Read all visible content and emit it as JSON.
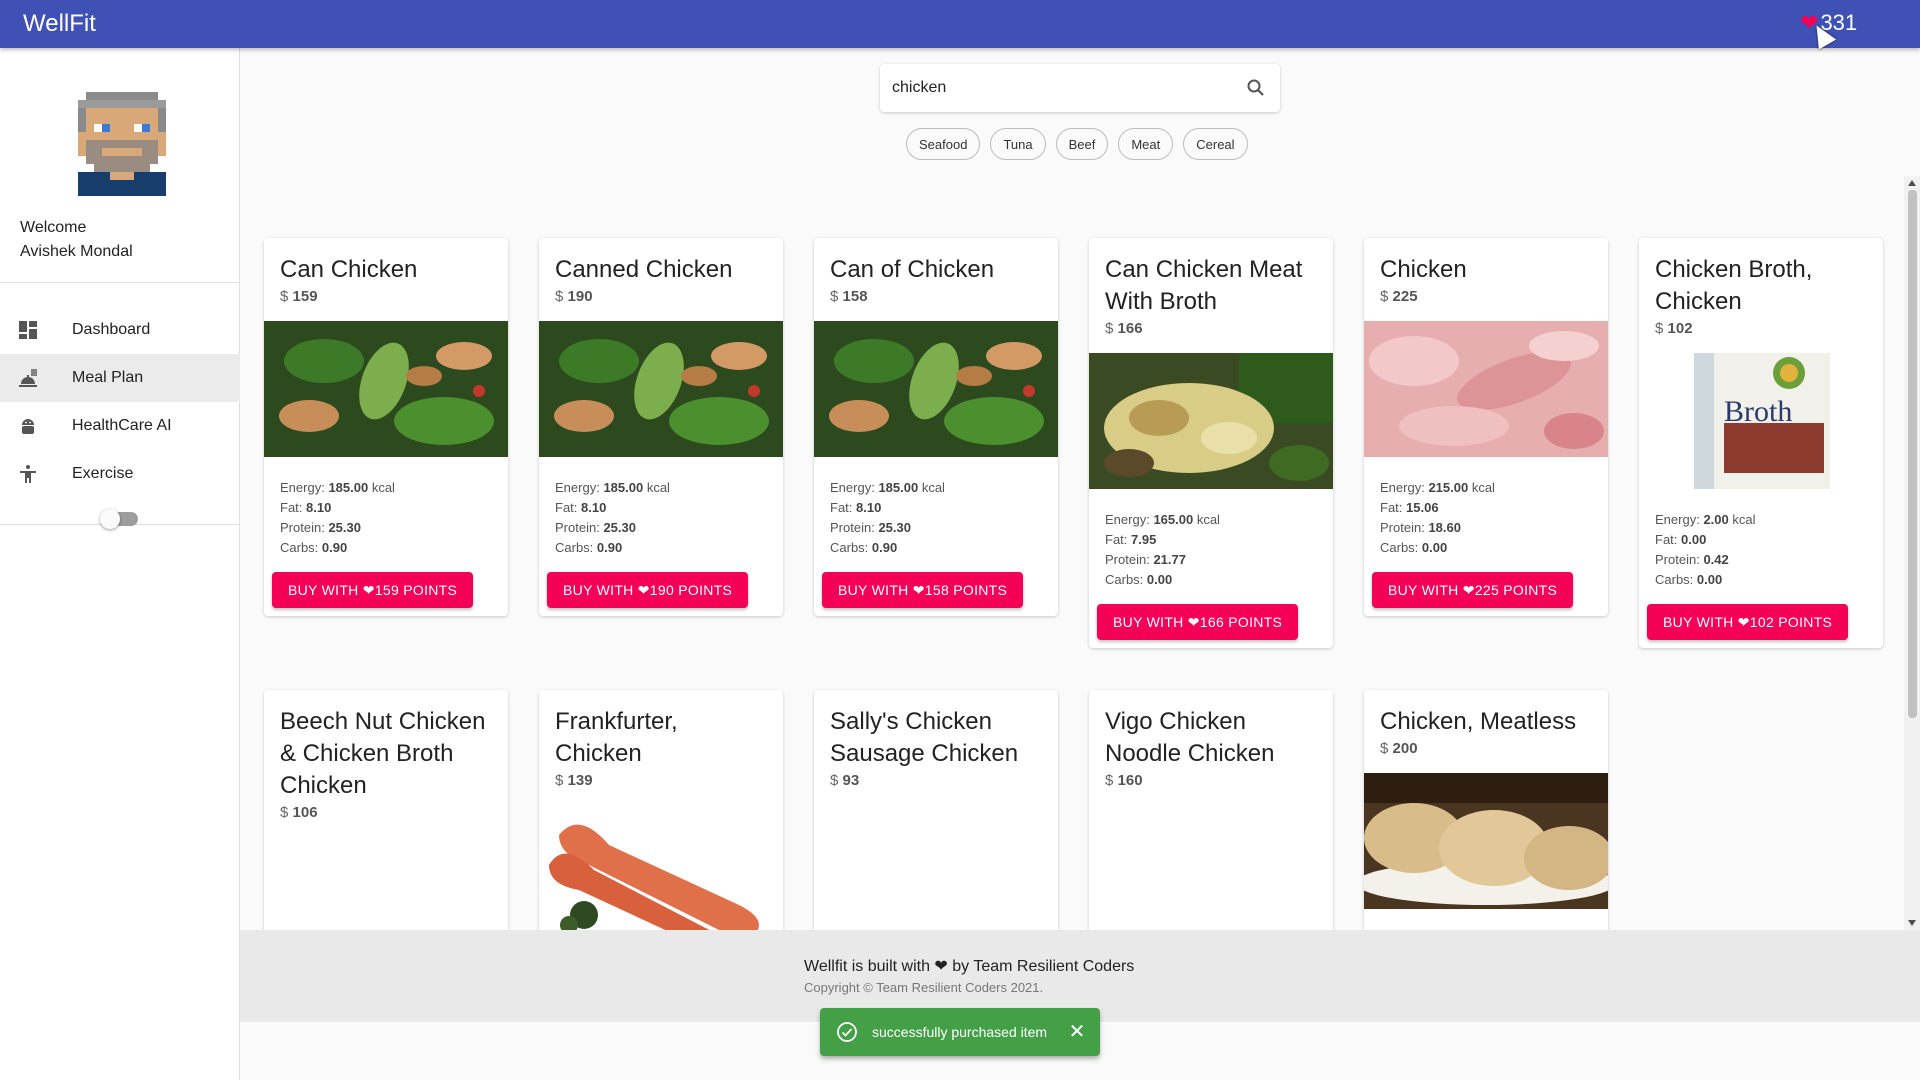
{
  "app": {
    "title": "WellFit",
    "points": "331"
  },
  "sidebar": {
    "welcome": "Welcome",
    "user_name": "Avishek Mondal",
    "items": [
      {
        "label": "Dashboard",
        "icon": "dashboard-icon"
      },
      {
        "label": "Meal Plan",
        "icon": "meal-plan-icon"
      },
      {
        "label": "HealthCare AI",
        "icon": "android-icon"
      },
      {
        "label": "Exercise",
        "icon": "accessibility-icon"
      }
    ]
  },
  "search": {
    "value": "chicken"
  },
  "chips": [
    "Seafood",
    "Tuna",
    "Beef",
    "Meat",
    "Cereal"
  ],
  "products": [
    {
      "title": "Can Chicken",
      "currency": "$",
      "price": "159",
      "energy": "185.00",
      "fat": "8.10",
      "protein": "25.30",
      "carbs": "0.90",
      "buy": "BUY WITH ❤159 POINTS"
    },
    {
      "title": "Canned Chicken",
      "currency": "$",
      "price": "190",
      "energy": "185.00",
      "fat": "8.10",
      "protein": "25.30",
      "carbs": "0.90",
      "buy": "BUY WITH ❤190 POINTS"
    },
    {
      "title": "Can of Chicken",
      "currency": "$",
      "price": "158",
      "energy": "185.00",
      "fat": "8.10",
      "protein": "25.30",
      "carbs": "0.90",
      "buy": "BUY WITH ❤158 POINTS"
    },
    {
      "title": "Can Chicken Meat With Broth",
      "currency": "$",
      "price": "166",
      "energy": "165.00",
      "fat": "7.95",
      "protein": "21.77",
      "carbs": "0.00",
      "buy": "BUY WITH ❤166 POINTS"
    },
    {
      "title": "Chicken",
      "currency": "$",
      "price": "225",
      "energy": "215.00",
      "fat": "15.06",
      "protein": "18.60",
      "carbs": "0.00",
      "buy": "BUY WITH ❤225 POINTS"
    },
    {
      "title": "Chicken Broth, Chicken",
      "currency": "$",
      "price": "102",
      "energy": "2.00",
      "fat": "0.00",
      "protein": "0.42",
      "carbs": "0.00",
      "buy": "BUY WITH ❤102 POINTS",
      "image_text": "Broth"
    },
    {
      "title": "Beech Nut Chicken & Chicken Broth Chicken",
      "currency": "$",
      "price": "106"
    },
    {
      "title": "Frankfurter, Chicken",
      "currency": "$",
      "price": "139"
    },
    {
      "title": "Sally's Chicken Sausage Chicken",
      "currency": "$",
      "price": "93"
    },
    {
      "title": "Vigo Chicken Noodle Chicken",
      "currency": "$",
      "price": "160"
    },
    {
      "title": "Chicken, Meatless",
      "currency": "$",
      "price": "200"
    }
  ],
  "labels": {
    "energy": "Energy:",
    "kcal": "kcal",
    "fat": "Fat:",
    "protein": "Protein:",
    "carbs": "Carbs:"
  },
  "footer": {
    "line1_pre": "Wellfit is built with",
    "line1_post": "by Team Resilient Coders",
    "line2": "Copyright © Team Resilient Coders 2021."
  },
  "snackbar": {
    "message": "successfully purchased item"
  },
  "colors": {
    "primary": "#3f51b5",
    "accent": "#f50057",
    "success": "#43a047"
  }
}
